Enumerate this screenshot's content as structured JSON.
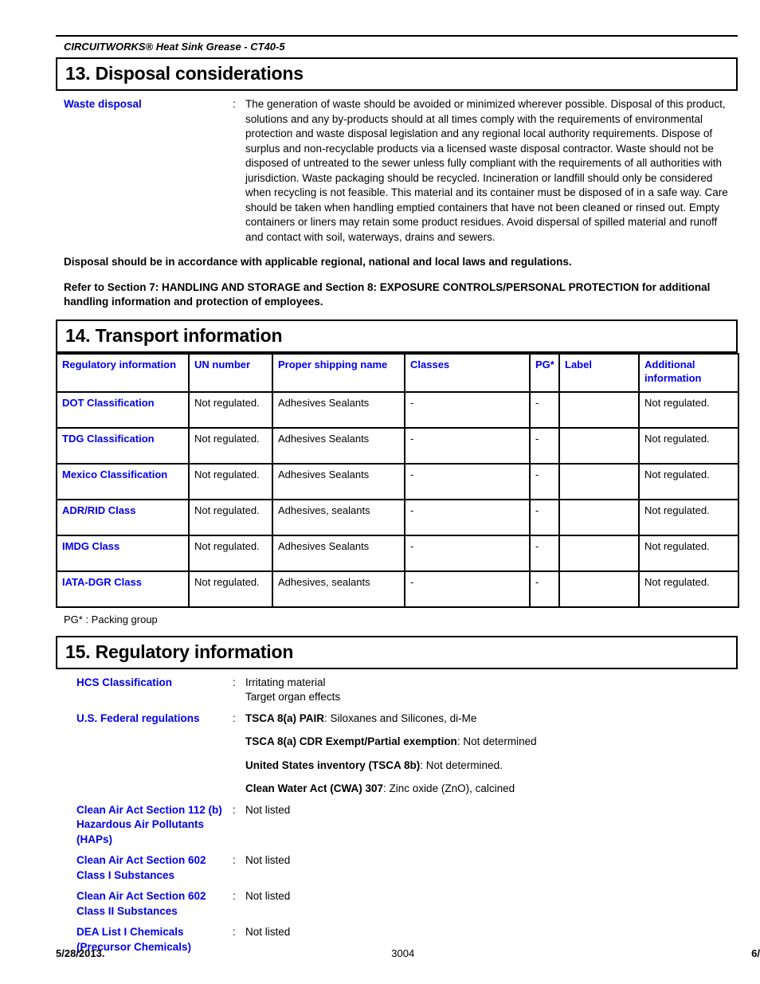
{
  "document": {
    "running_header": "CIRCUITWORKS® Heat Sink Grease - CT40-5"
  },
  "section13": {
    "title": "13. Disposal considerations",
    "waste_disposal": {
      "label": "Waste disposal",
      "colon": ":",
      "text": "The generation of waste should be avoided or minimized wherever possible.  Disposal of this product, solutions and any by-products should at all times comply with the requirements of environmental protection and waste disposal legislation and any regional local authority requirements.  Dispose of surplus and non-recyclable products via a licensed waste disposal contractor.  Waste should not be disposed of untreated to the sewer unless fully compliant with the requirements of all authorities with jurisdiction.  Waste packaging should be recycled.  Incineration or landfill should only be considered when recycling is not feasible.  This material and its container must be disposed of in a safe way.  Care should be taken when handling emptied containers that have not been cleaned or rinsed out.  Empty containers or liners may retain some product residues.  Avoid dispersal of spilled material and runoff and contact with soil, waterways, drains and sewers."
    },
    "statement_1": "Disposal should be in accordance with applicable regional, national and local laws and regulations.",
    "statement_2": "Refer to Section 7: HANDLING AND STORAGE and Section 8: EXPOSURE CONTROLS/PERSONAL PROTECTION for additional handling information and protection of employees."
  },
  "section14": {
    "title": "14. Transport information",
    "table": {
      "headers": [
        "Regulatory information",
        "UN number",
        "Proper shipping name",
        "Classes",
        "PG*",
        "Label",
        "Additional information"
      ],
      "rows": [
        {
          "regulatory": "DOT Classification",
          "un_number": "Not regulated.",
          "shipping_name": "Adhesives Sealants",
          "classes": "-",
          "pg": "-",
          "label": "",
          "additional": "Not regulated."
        },
        {
          "regulatory": "TDG Classification",
          "un_number": "Not regulated.",
          "shipping_name": "Adhesives Sealants",
          "classes": "-",
          "pg": "-",
          "label": "",
          "additional": "Not regulated."
        },
        {
          "regulatory": "Mexico Classification",
          "un_number": "Not regulated.",
          "shipping_name": "Adhesives Sealants",
          "classes": "-",
          "pg": "-",
          "label": "",
          "additional": "Not regulated."
        },
        {
          "regulatory": "ADR/RID Class",
          "un_number": "Not regulated.",
          "shipping_name": "Adhesives, sealants",
          "classes": "-",
          "pg": "-",
          "label": "",
          "additional": "Not regulated."
        },
        {
          "regulatory": "IMDG Class",
          "un_number": "Not regulated.",
          "shipping_name": "Adhesives Sealants",
          "classes": "-",
          "pg": "-",
          "label": "",
          "additional": "Not regulated."
        },
        {
          "regulatory": "IATA-DGR Class",
          "un_number": "Not regulated.",
          "shipping_name": "Adhesives, sealants",
          "classes": "-",
          "pg": "-",
          "label": "",
          "additional": "Not regulated."
        }
      ]
    },
    "note": "PG* : Packing group"
  },
  "section15": {
    "title": "15. Regulatory information",
    "hcs": {
      "label": "HCS Classification",
      "colon": ":",
      "line1": "Irritating material",
      "line2": "Target organ effects"
    },
    "federal": {
      "label": "U.S. Federal regulations",
      "colon": ":",
      "items": [
        {
          "bold": "TSCA 8(a) PAIR",
          "rest": ": Siloxanes and Silicones, di-Me"
        },
        {
          "bold": "TSCA 8(a) CDR Exempt/Partial exemption",
          "rest": ": Not determined"
        },
        {
          "bold": "United States inventory (TSCA 8b)",
          "rest": ": Not determined."
        },
        {
          "bold": "Clean Water Act (CWA) 307",
          "rest": ": Zinc oxide (ZnO), calcined"
        }
      ]
    },
    "caa_112": {
      "label": "Clean Air Act  Section 112 (b) Hazardous Air Pollutants (HAPs)",
      "colon": ":",
      "value": "Not listed"
    },
    "caa_602_i": {
      "label": "Clean Air Act Section 602 Class I Substances",
      "colon": ":",
      "value": "Not listed"
    },
    "caa_602_ii": {
      "label": "Clean Air Act Section 602 Class II Substances",
      "colon": ":",
      "value": "Not listed"
    },
    "dea": {
      "label": "DEA List I Chemicals (Precursor Chemicals)",
      "colon": ":",
      "value": "Not listed"
    }
  },
  "footer": {
    "date": "5/28/2013.",
    "doc_number": "3004",
    "page": "6/"
  },
  "colors": {
    "heading_blue": "#0000ee",
    "text_black": "#000000",
    "background": "#ffffff"
  }
}
